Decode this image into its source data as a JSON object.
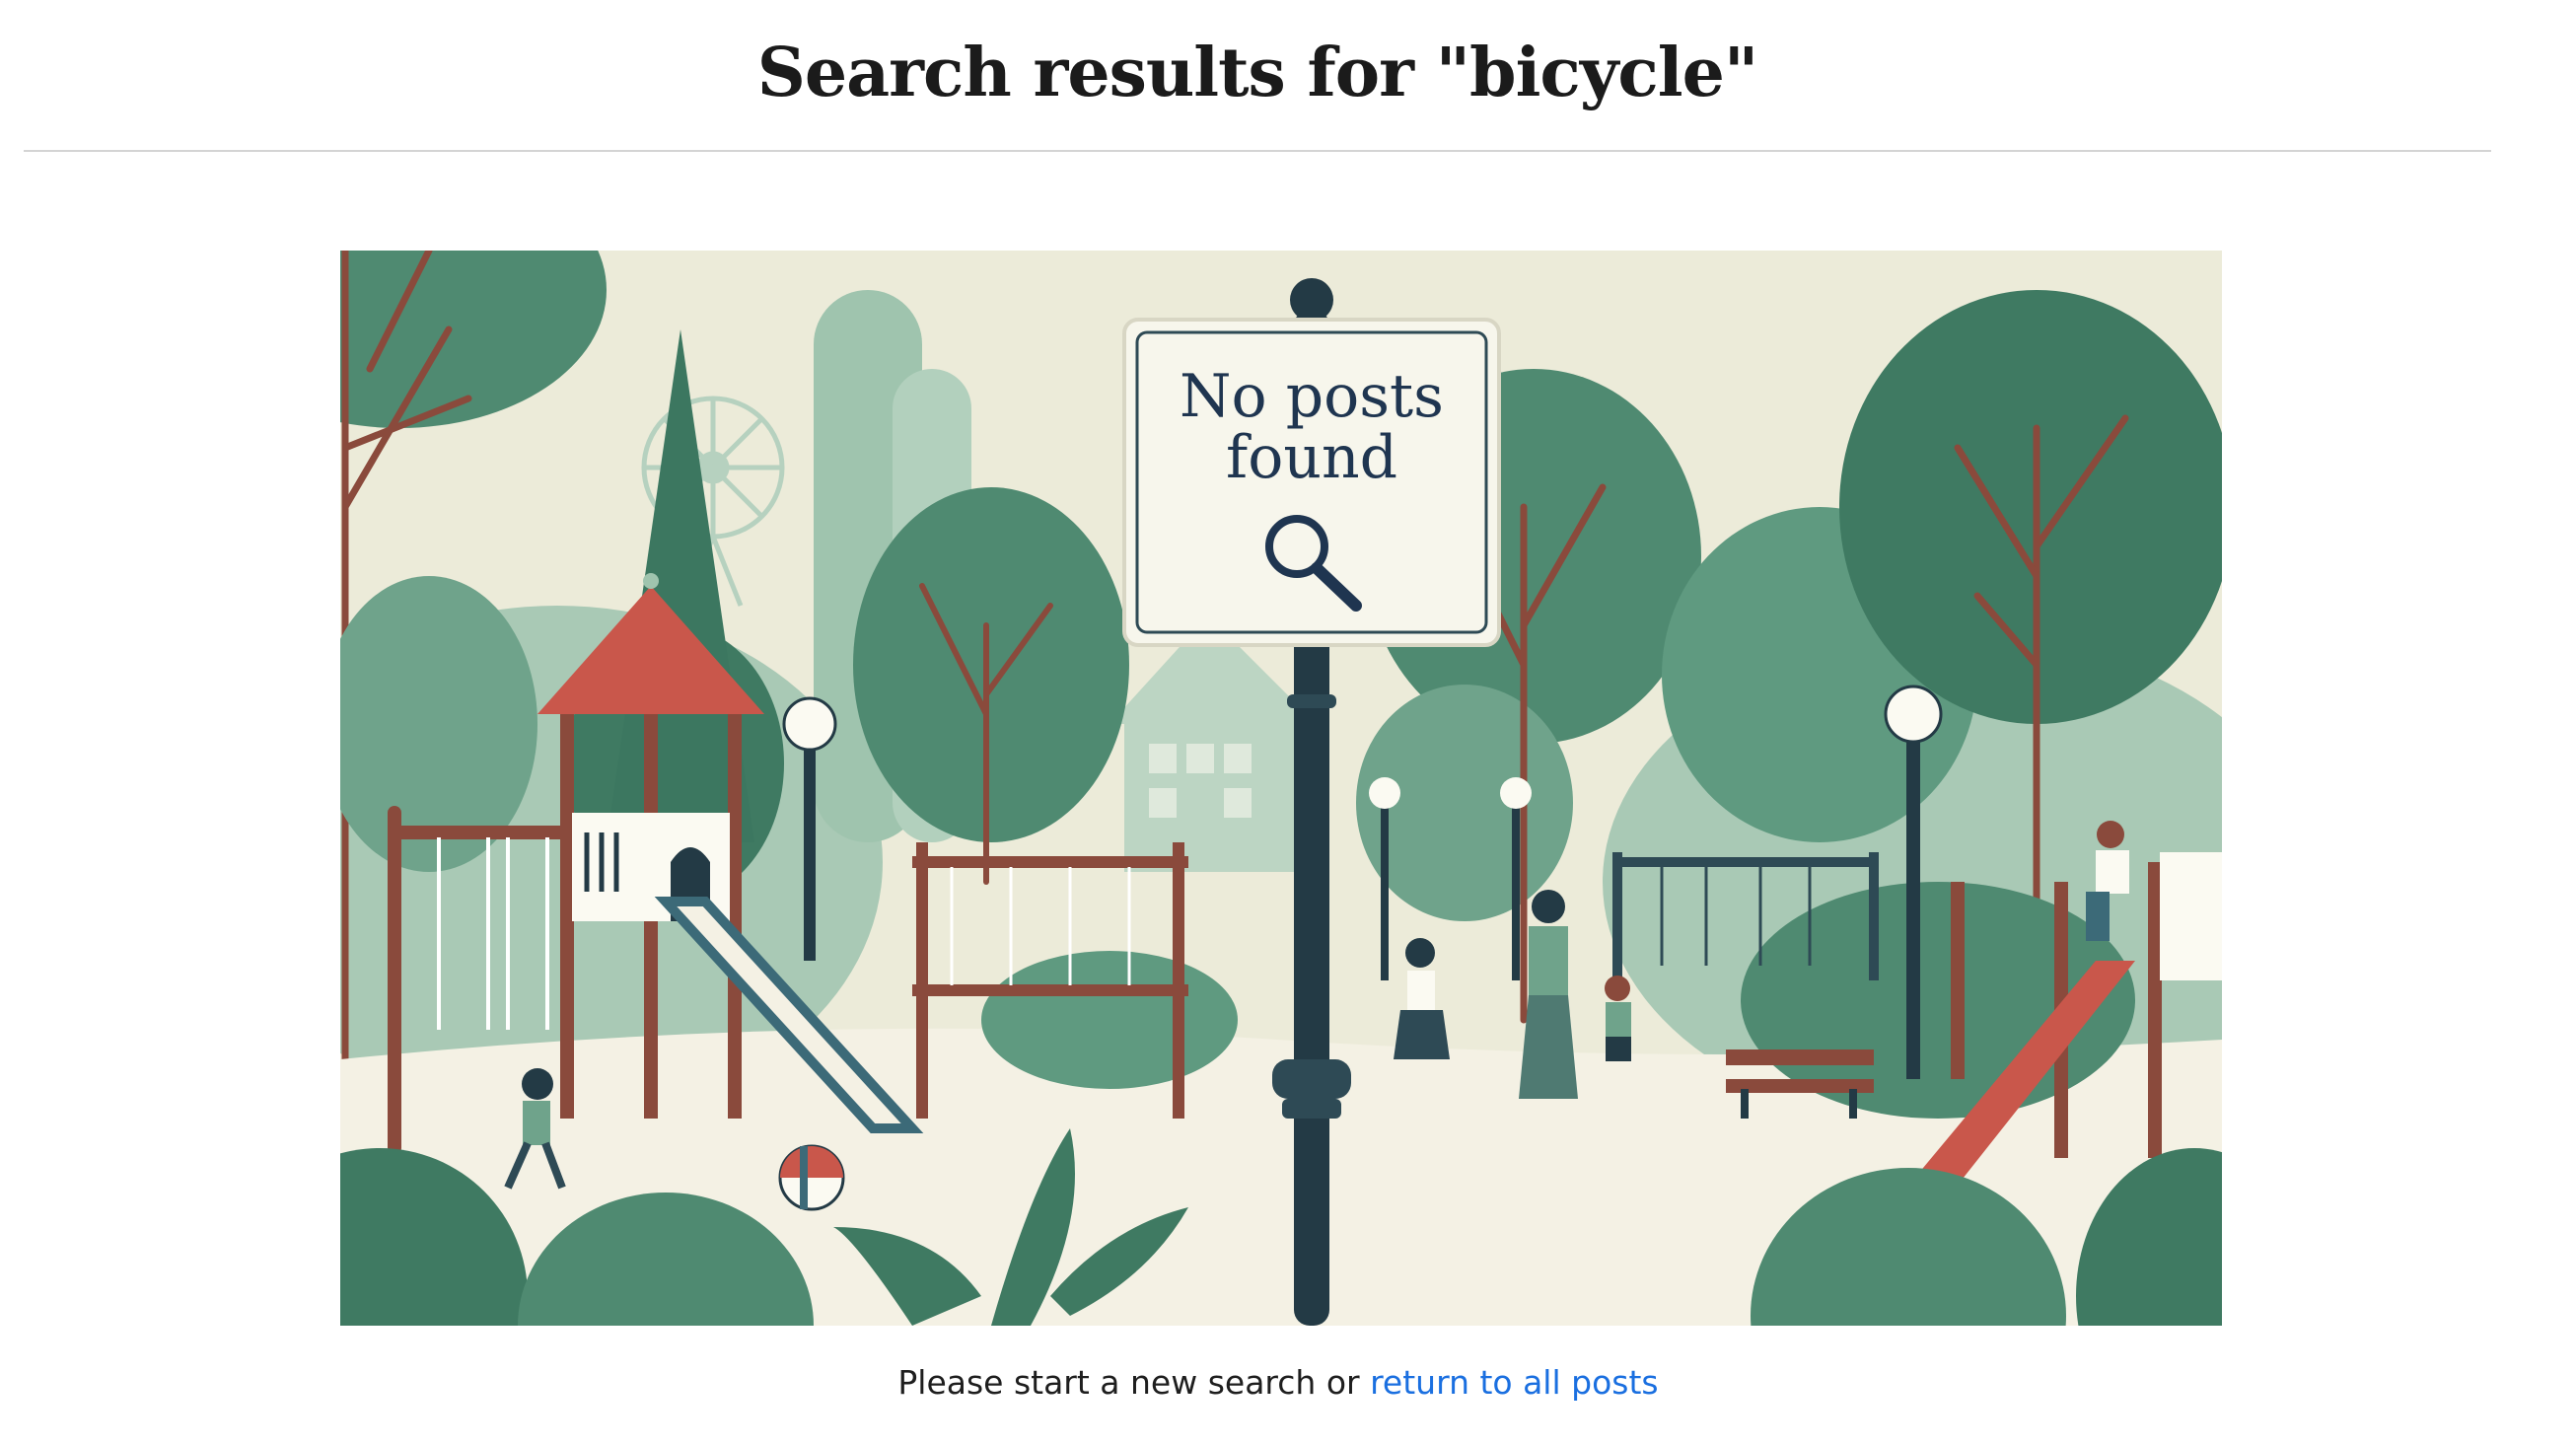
{
  "header": {
    "title": "Search results for \"bicycle\""
  },
  "illustration": {
    "sign_line_1": "No posts",
    "sign_line_2": "found",
    "sign_icon": "magnifier-icon",
    "palette": {
      "background": "#ecebd9",
      "green_dark": "#3f7a62",
      "green_mid": "#5f9a80",
      "green_light": "#9fc4ae",
      "pole": "#233a45",
      "brown": "#8a4a3c",
      "red_roof": "#c9574b",
      "ground": "#f4f1e4"
    }
  },
  "message": {
    "prefix": "Please start a new search or ",
    "link_label": "return to all posts",
    "link_color": "#1a6fe0"
  }
}
